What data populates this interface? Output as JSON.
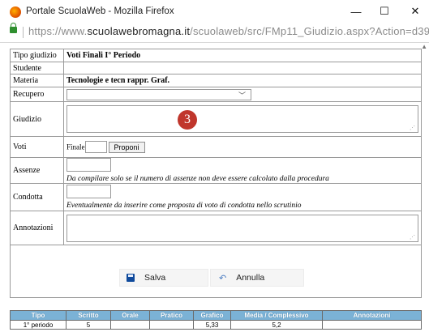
{
  "window": {
    "title": "Portale ScuolaWeb - Mozilla Firefox",
    "minimize": "—",
    "maximize": "☐",
    "close": "✕"
  },
  "address": {
    "prefix": "https://www.",
    "domain": "scuolawebromagna.it",
    "path": "/scuolaweb/src/FMp11_Giudizio.aspx?Action=d39("
  },
  "form": {
    "tipo_giudizio_label": "Tipo giudizio",
    "tipo_giudizio_value": "Voti Finali I° Periodo",
    "studente_label": "Studente",
    "studente_value": "",
    "materia_label": "Materia",
    "materia_value": "Tecnologie e tecn rappr. Graf.",
    "recupero_label": "Recupero",
    "recupero_value": "",
    "giudizio_label": "Giudizio",
    "badge": "3",
    "voti_label": "Voti",
    "finale_label": "Finale",
    "finale_value": "",
    "proponi_label": "Proponi",
    "assenze_label": "Assenze",
    "assenze_value": "",
    "assenze_note": "Da compilare solo se il numero di assenze non deve essere calcolato dalla procedura",
    "condotta_label": "Condotta",
    "condotta_value": "",
    "condotta_note": "Eventualmente da inserire come proposta di voto di condotta nello scrutinio",
    "annotazioni_label": "Annotazioni"
  },
  "actions": {
    "salva": "Salva",
    "annulla": "Annulla"
  },
  "summary": {
    "headers": [
      "Tipo",
      "Scritto",
      "Orale",
      "Pratico",
      "Grafico",
      "Media / Complessivo",
      "Annotazioni"
    ],
    "rows": [
      [
        "1° periodo",
        "5",
        "",
        "",
        "5,33",
        "5,2",
        ""
      ]
    ]
  },
  "colors": {
    "header_bg": "#7bb2d6",
    "badge": "#c0362c"
  }
}
